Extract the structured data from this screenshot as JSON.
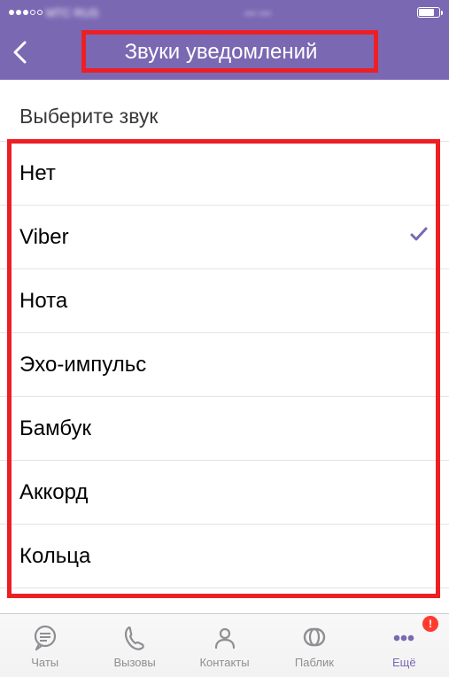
{
  "status_bar": {
    "carrier": "МТС RUS"
  },
  "nav": {
    "title": "Звуки уведомлений"
  },
  "section": {
    "header": "Выберите звук"
  },
  "sounds": [
    {
      "label": "Нет",
      "selected": false
    },
    {
      "label": "Viber",
      "selected": true
    },
    {
      "label": "Нота",
      "selected": false
    },
    {
      "label": "Эхо-импульс",
      "selected": false
    },
    {
      "label": "Бамбук",
      "selected": false
    },
    {
      "label": "Аккорд",
      "selected": false
    },
    {
      "label": "Кольца",
      "selected": false
    }
  ],
  "tabs": [
    {
      "label": "Чаты",
      "icon": "chat",
      "active": false
    },
    {
      "label": "Вызовы",
      "icon": "phone",
      "active": false
    },
    {
      "label": "Контакты",
      "icon": "contacts",
      "active": false
    },
    {
      "label": "Паблик",
      "icon": "public",
      "active": false
    },
    {
      "label": "Ещё",
      "icon": "more",
      "active": true,
      "badge": "!"
    }
  ]
}
